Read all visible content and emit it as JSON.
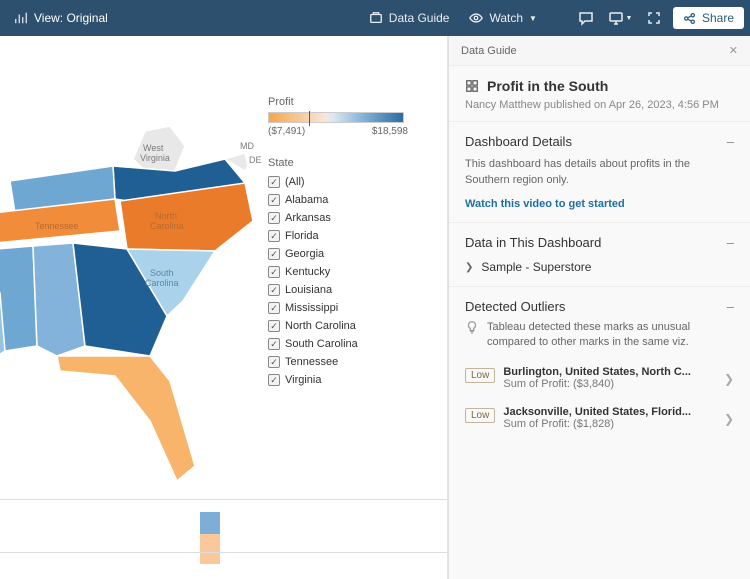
{
  "topbar": {
    "view_label": "View: Original",
    "data_guide": "Data Guide",
    "watch": "Watch",
    "share": "Share"
  },
  "legend": {
    "title": "Profit",
    "min_label": "($7,491)",
    "max_label": "$18,598"
  },
  "state_filter": {
    "title": "State",
    "all_label": "(All)",
    "items": [
      "Alabama",
      "Arkansas",
      "Florida",
      "Georgia",
      "Kentucky",
      "Louisiana",
      "Mississippi",
      "North Carolina",
      "South Carolina",
      "Tennessee",
      "Virginia"
    ]
  },
  "map_labels": {
    "wv": "West\nVirginia",
    "tn": "Tennessee",
    "nc": "North\nCarolina",
    "sc": "South\nCarolina",
    "md": "MD",
    "de": "DE"
  },
  "panel": {
    "heading": "Data Guide",
    "title": "Profit in the South",
    "byline": "Nancy Matthew published on Apr 26, 2023, 4:56 PM"
  },
  "details": {
    "heading": "Dashboard Details",
    "desc": "This dashboard has details about profits in the Southern region only.",
    "link": "Watch this video to get started"
  },
  "data_in": {
    "heading": "Data in This Dashboard",
    "source": "Sample - Superstore"
  },
  "outliers": {
    "heading": "Detected Outliers",
    "desc": "Tableau detected these marks as unusual compared to other marks in the same viz.",
    "low_label": "Low",
    "items": [
      {
        "title": "Burlington, United States, North C...",
        "sub": "Sum of Profit: ($3,840)"
      },
      {
        "title": "Jacksonville, United States, Florid...",
        "sub": "Sum of Profit: ($1,828)"
      }
    ]
  },
  "chart_data": {
    "type": "choropleth-map",
    "title": "Profit in the South",
    "color_scale": {
      "field": "Profit",
      "min": -7491,
      "max": 18598,
      "palette": "orange-blue-diverging"
    },
    "regions": [
      {
        "state": "Virginia",
        "color": "#1f5f93"
      },
      {
        "state": "West Virginia",
        "color": "#e8e8e8",
        "excluded": true
      },
      {
        "state": "Kentucky",
        "color": "#6ea7d1"
      },
      {
        "state": "Tennessee",
        "color": "#f18c3a"
      },
      {
        "state": "North Carolina",
        "color": "#ea7b2b"
      },
      {
        "state": "South Carolina",
        "color": "#abd2eb"
      },
      {
        "state": "Georgia",
        "color": "#1f5f93"
      },
      {
        "state": "Florida",
        "color": "#f8b46a"
      },
      {
        "state": "Alabama",
        "color": "#83b3da"
      },
      {
        "state": "Mississippi",
        "color": "#6ea7d1"
      },
      {
        "state": "Louisiana",
        "color": "#97c3e2"
      },
      {
        "state": "Arkansas",
        "color": "#8dbde0"
      }
    ]
  }
}
